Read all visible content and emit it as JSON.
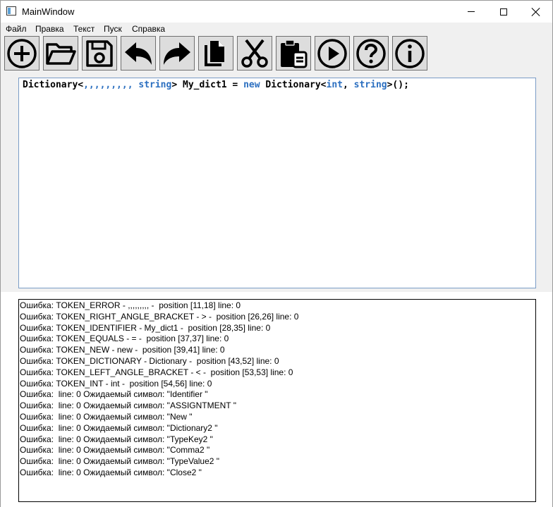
{
  "window": {
    "title": "MainWindow"
  },
  "menu": {
    "items": [
      "Файл",
      "Правка",
      "Текст",
      "Пуск",
      "Справка"
    ]
  },
  "toolbar": {
    "buttons": [
      {
        "icon": "plus-circle-icon"
      },
      {
        "icon": "folder-open-icon"
      },
      {
        "icon": "save-icon"
      },
      {
        "icon": "undo-icon"
      },
      {
        "icon": "redo-icon"
      },
      {
        "icon": "copy-icon"
      },
      {
        "icon": "cut-icon"
      },
      {
        "icon": "paste-icon"
      },
      {
        "icon": "play-icon"
      },
      {
        "icon": "help-icon"
      },
      {
        "icon": "info-icon"
      }
    ]
  },
  "editor": {
    "tokens": [
      {
        "text": "Dictionary<",
        "kw": false
      },
      {
        "text": ",,,,,,,,,",
        "kw": true
      },
      {
        "text": " ",
        "kw": false
      },
      {
        "text": "string",
        "kw": true
      },
      {
        "text": "> My_dict1 = ",
        "kw": false
      },
      {
        "text": "new",
        "kw": true
      },
      {
        "text": " Dictionary<",
        "kw": false
      },
      {
        "text": "int",
        "kw": true
      },
      {
        "text": ", ",
        "kw": false
      },
      {
        "text": "string",
        "kw": true
      },
      {
        "text": ">();",
        "kw": false
      }
    ]
  },
  "output": {
    "lines": [
      "Ошибка: TOKEN_ERROR - ,,,,,,,,, -  position [11,18] line: 0",
      "Ошибка: TOKEN_RIGHT_ANGLE_BRACKET - > -  position [26,26] line: 0",
      "Ошибка: TOKEN_IDENTIFIER - My_dict1 -  position [28,35] line: 0",
      "Ошибка: TOKEN_EQUALS - = -  position [37,37] line: 0",
      "Ошибка: TOKEN_NEW - new -  position [39,41] line: 0",
      "Ошибка: TOKEN_DICTIONARY - Dictionary -  position [43,52] line: 0",
      "Ошибка: TOKEN_LEFT_ANGLE_BRACKET - < -  position [53,53] line: 0",
      "Ошибка: TOKEN_INT - int -  position [54,56] line: 0",
      "Ошибка:  line: 0 Ожидаемый символ: \"Identifier \"",
      "Ошибка:  line: 0 Ожидаемый символ: \"ASSIGNTMENT \"",
      "Ошибка:  line: 0 Ожидаемый символ: \"New \"",
      "Ошибка:  line: 0 Ожидаемый символ: \"Dictionary2 \"",
      "Ошибка:  line: 0 Ожидаемый символ: \"TypeKey2 \"",
      "Ошибка:  line: 0 Ожидаемый символ: \"Comma2 \"",
      "Ошибка:  line: 0 Ожидаемый символ: \"TypeValue2 \"",
      "Ошибка:  line: 0 Ожидаемый символ: \"Close2 \""
    ]
  }
}
